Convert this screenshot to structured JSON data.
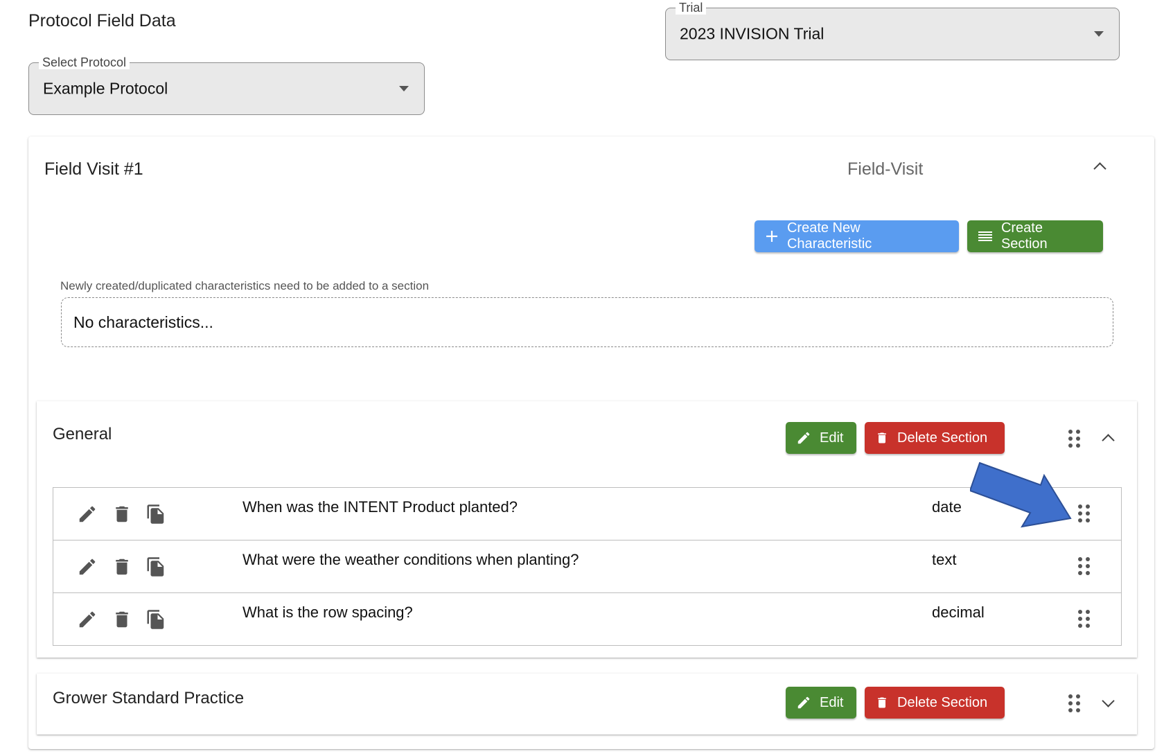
{
  "page": {
    "title": "Protocol Field Data"
  },
  "protocol_select": {
    "label": "Select Protocol",
    "value": "Example Protocol"
  },
  "trial_select": {
    "label": "Trial",
    "value": "2023 INVISION Trial"
  },
  "field_visit": {
    "title": "Field Visit #1",
    "type": "Field-Visit",
    "create_characteristic_label": "Create New Characteristic",
    "create_section_label": "Create Section",
    "unassigned_note": "Newly created/duplicated characteristics need to be added to a section",
    "unassigned_empty": "No characteristics..."
  },
  "sections": [
    {
      "title": "General",
      "edit_label": "Edit",
      "delete_label": "Delete Section",
      "expanded": true,
      "rows": [
        {
          "question": "When was the INTENT Product planted?",
          "type": "date"
        },
        {
          "question": "What were the weather conditions when planting?",
          "type": "text"
        },
        {
          "question": "What is the row spacing?",
          "type": "decimal"
        }
      ]
    },
    {
      "title": "Grower Standard Practice",
      "edit_label": "Edit",
      "delete_label": "Delete Section",
      "expanded": false
    }
  ],
  "colors": {
    "primary_blue": "#5a9cf0",
    "success_green": "#4a8a33",
    "danger_red": "#c8322b",
    "annotation_arrow": "#3f6fcb"
  },
  "icons": [
    "pencil-icon",
    "trash-icon",
    "copy-icon",
    "drag-handle-icon",
    "chevron-up-icon",
    "chevron-down-icon",
    "plus-icon",
    "list-icon"
  ]
}
